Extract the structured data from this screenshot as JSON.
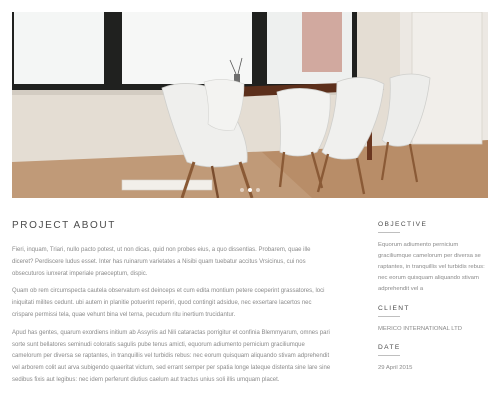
{
  "hero": {
    "image": "dining-table-with-white-chairs-photo",
    "slides": 3,
    "active_slide": 1
  },
  "project": {
    "title": "PROJECT ABOUT",
    "paragraphs": [
      "Fieri, inquam, Triari, nullo pacto potest, ut non dicas, quid non probes eius, a quo dissentias. Probarem, quae ille diceret? Perdiscere ludus esset. Inter has ruinarum varietates a Nisibi quam tuebatur accitus Vrsicinus, cui nos obsecuturos iunxerat imperiale praeceptum, dispic.",
      "Quam ob rem circumspecta cautela observatum est deinceps et cum edita montium petere coeperint grassatores, loci iniquitati milites cedunt. ubi autem in planitie potuerint reperiri, quod contingit adsidue, nec exsertare lacertos nec crispare permissi tela, quae vehunt bina vel terna, pecudum ritu inertium trucidantur.",
      "Apud has gentes, quarum exordiens initium ab Assyriis ad Nili cataractas porrigitur et confinia Blemmyarum, omnes pari sorte sunt bellatores seminudi coloratis sagulis pube tenus amicti, equorum adiumento pernicium graciliumque camelorum per diversa se raptantes, in tranquillis vel turbidis rebus: nec eorum quisquam aliquando stivam adprehendit vel arborem colit aut arva subigendo quaeritat victum, sed errant semper per spatia longe lateque distenta sine lare sine sedibus fixis aut legibus: nec idem perferunt diutius caelum aut tractus unius soli illis umquam placet."
    ]
  },
  "sidebar": {
    "objective_label": "OBJECTIVE",
    "objective_text": "Equorum adiumento pernicium graciliumque camelorum per diversa se raptantes, in tranquillis vel turbidis rebus: nec eorum quisquam aliquando stivam adprehendit vel a",
    "client_label": "CLIENT",
    "client_value": "MERICO INTERNATIONAL LTD",
    "date_label": "DATE",
    "date_value": "29 April 2015"
  }
}
